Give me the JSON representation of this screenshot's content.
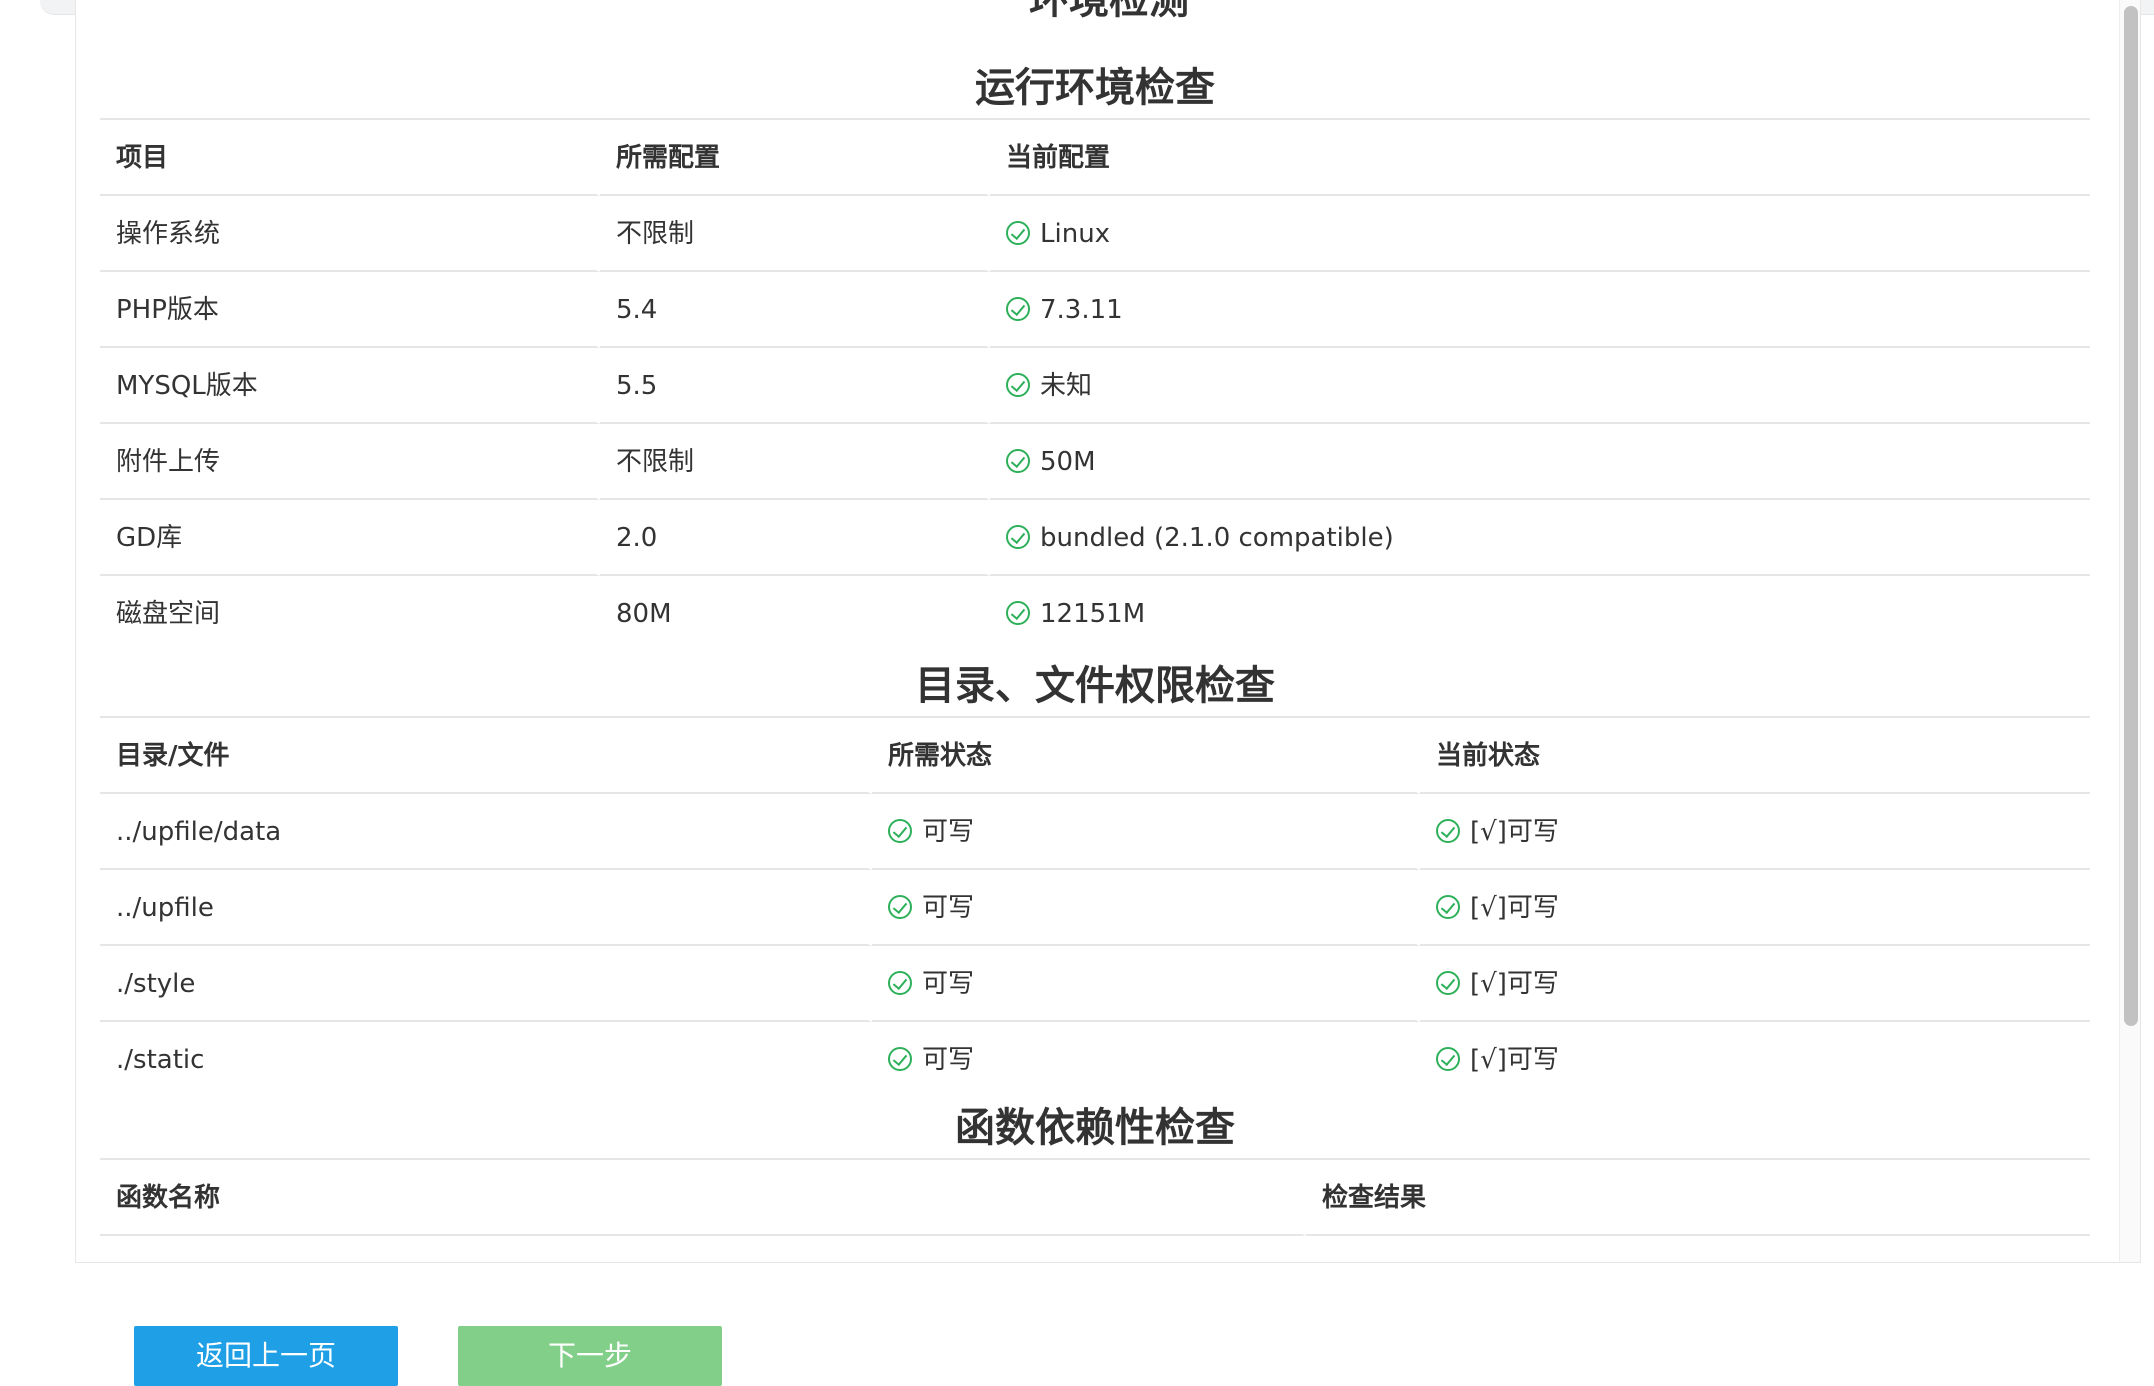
{
  "header_partial": "环境检测",
  "env_section": {
    "title": "运行环境检查",
    "columns": [
      "项目",
      "所需配置",
      "当前配置"
    ],
    "rows": [
      {
        "item": "操作系统",
        "required": "不限制",
        "current": "Linux"
      },
      {
        "item": "PHP版本",
        "required": "5.4",
        "current": "7.3.11"
      },
      {
        "item": "MYSQL版本",
        "required": "5.5",
        "current": "未知"
      },
      {
        "item": "附件上传",
        "required": "不限制",
        "current": "50M"
      },
      {
        "item": "GD库",
        "required": "2.0",
        "current": "bundled (2.1.0 compatible)"
      },
      {
        "item": "磁盘空间",
        "required": "80M",
        "current": "12151M"
      }
    ]
  },
  "dir_section": {
    "title": "目录、文件权限检查",
    "columns": [
      "目录/文件",
      "所需状态",
      "当前状态"
    ],
    "rows": [
      {
        "path": "../upfile/data",
        "required": "可写",
        "current": "[√]可写"
      },
      {
        "path": "../upfile",
        "required": "可写",
        "current": "[√]可写"
      },
      {
        "path": "./style",
        "required": "可写",
        "current": "[√]可写"
      },
      {
        "path": "./static",
        "required": "可写",
        "current": "[√]可写"
      }
    ]
  },
  "func_section": {
    "title": "函数依赖性检查",
    "columns": [
      "函数名称",
      "检查结果"
    ]
  },
  "buttons": {
    "back": "返回上一页",
    "next": "下一步"
  },
  "icons": {
    "status": "check-circle-icon"
  },
  "colors": {
    "check": "#2eb05a",
    "back_button": "#1e9fe6",
    "next_button": "#82cf8a"
  }
}
